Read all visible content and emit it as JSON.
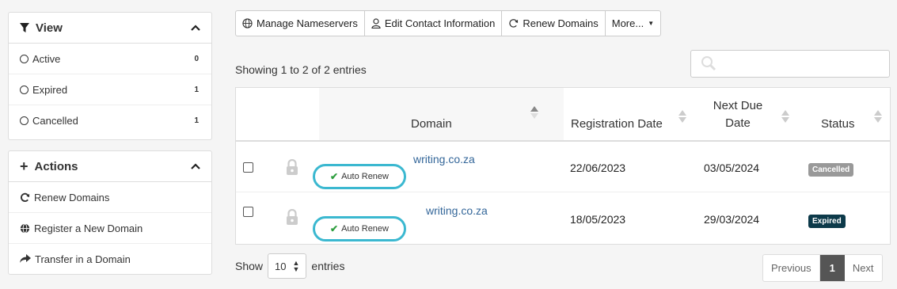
{
  "view_panel": {
    "title": "View",
    "items": [
      {
        "label": "Active",
        "count": "0"
      },
      {
        "label": "Expired",
        "count": "1"
      },
      {
        "label": "Cancelled",
        "count": "1"
      }
    ]
  },
  "actions_panel": {
    "title": "Actions",
    "items": [
      {
        "label": "Renew Domains",
        "icon": "refresh-icon"
      },
      {
        "label": "Register a New Domain",
        "icon": "globe-icon"
      },
      {
        "label": "Transfer in a Domain",
        "icon": "share-arrow-icon"
      }
    ]
  },
  "toolbar": {
    "manage_nameservers": "Manage Nameservers",
    "edit_contact": "Edit Contact Information",
    "renew_domains": "Renew Domains",
    "more": "More..."
  },
  "table": {
    "showing_text": "Showing 1 to 2 of 2 entries",
    "headers": {
      "domain": "Domain",
      "registration_date": "Registration Date",
      "next_due_date_line1": "Next Due",
      "next_due_date_line2": "Date",
      "status": "Status"
    },
    "rows": [
      {
        "domain": "writing.co.za",
        "auto_renew": "Auto Renew",
        "registration_date": "22/06/2023",
        "next_due_date": "03/05/2024",
        "status": "Cancelled",
        "status_color": "#999999"
      },
      {
        "domain": "writing.co.za",
        "auto_renew": "Auto Renew",
        "registration_date": "18/05/2023",
        "next_due_date": "29/03/2024",
        "status": "Expired",
        "status_color": "#0d3a4a"
      }
    ]
  },
  "footer": {
    "show_label": "Show",
    "page_size": "10",
    "entries_label": "entries"
  },
  "pagination": {
    "previous": "Previous",
    "current_page": "1",
    "next": "Next"
  },
  "colors": {
    "link": "#336699",
    "highlight": "#3bb8d0"
  }
}
